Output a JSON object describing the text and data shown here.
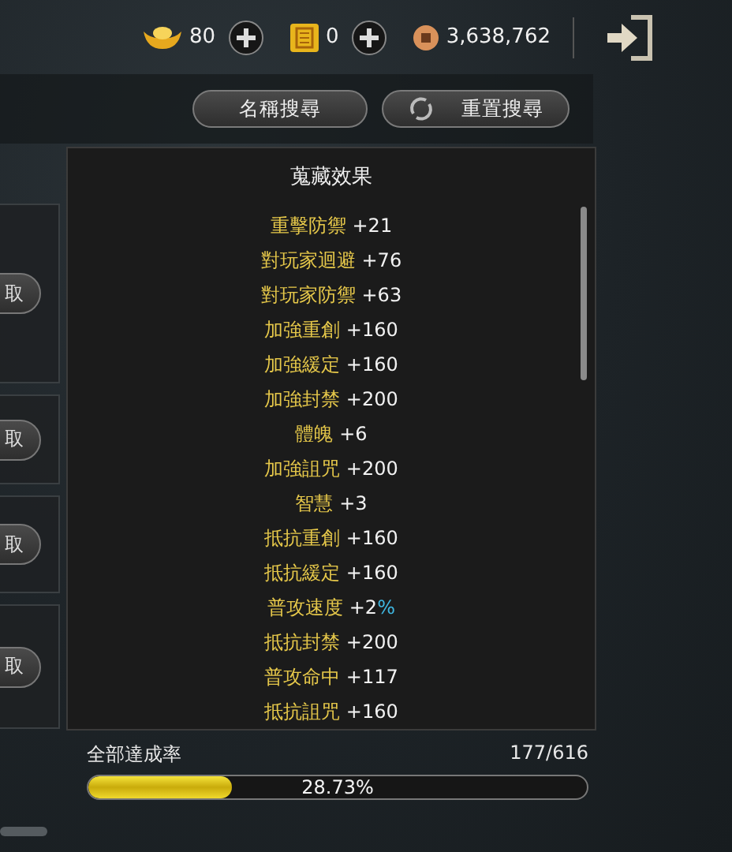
{
  "currencies": [
    {
      "kind": "ingot",
      "amount": "80",
      "addable": true
    },
    {
      "kind": "seal",
      "amount": "0",
      "addable": true
    },
    {
      "kind": "coin",
      "amount": "3,638,762",
      "addable": false
    }
  ],
  "search_buttons": [
    {
      "kind": "name",
      "label": "名稱搜尋"
    },
    {
      "kind": "reset",
      "label": "重置搜尋"
    }
  ],
  "side_cards": [
    {
      "button": "取"
    },
    {
      "button": "取"
    },
    {
      "button": "取"
    },
    {
      "button": "取"
    }
  ],
  "panel": {
    "title": "蒐藏效果",
    "effects": [
      {
        "name": "重擊防禦",
        "value": "+21"
      },
      {
        "name": "對玩家迴避",
        "value": "+76"
      },
      {
        "name": "對玩家防禦",
        "value": "+63"
      },
      {
        "name": "加強重創",
        "value": "+160"
      },
      {
        "name": "加強緩定",
        "value": "+160"
      },
      {
        "name": "加強封禁",
        "value": "+200"
      },
      {
        "name": "體魄",
        "value": "+6"
      },
      {
        "name": "加強詛咒",
        "value": "+200"
      },
      {
        "name": "智慧",
        "value": "+3"
      },
      {
        "name": "抵抗重創",
        "value": "+160"
      },
      {
        "name": "抵抗緩定",
        "value": "+160"
      },
      {
        "name": "普攻速度",
        "value": "+2",
        "unit": "%"
      },
      {
        "name": "抵抗封禁",
        "value": "+200"
      },
      {
        "name": "普攻命中",
        "value": "+117"
      },
      {
        "name": "抵抗詛咒",
        "value": "+160"
      }
    ]
  },
  "completion": {
    "label": "全部達成率",
    "count": "177/616",
    "level": 0.2873,
    "percent": "28.73%"
  }
}
